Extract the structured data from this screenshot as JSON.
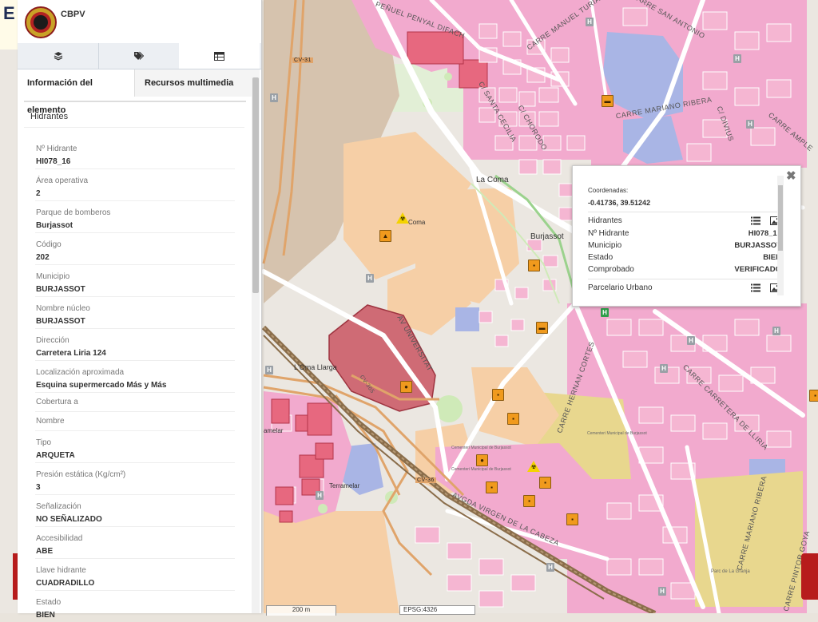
{
  "app": {
    "title": "CBPV"
  },
  "tabs": [
    {
      "icon": "layers-icon"
    },
    {
      "icon": "tags-icon"
    },
    {
      "icon": "table-icon"
    }
  ],
  "subtabs": {
    "info": "Información del elemento",
    "media": "Recursos multimedia"
  },
  "layer_title": "Hidrantes",
  "fields": [
    {
      "label": "Nº Hidrante",
      "value": "HI078_16"
    },
    {
      "label": "Área operativa",
      "value": "2"
    },
    {
      "label": "Parque de bomberos",
      "value": "Burjassot"
    },
    {
      "label": "Código",
      "value": "202"
    },
    {
      "label": "Municipio",
      "value": "BURJASSOT"
    },
    {
      "label": "Nombre núcleo",
      "value": "BURJASSOT"
    },
    {
      "label": "Dirección",
      "value": "Carretera Liria 124"
    },
    {
      "label": "Localización aproximada",
      "value": "Esquina supermercado Más y Más"
    },
    {
      "label": "Cobertura a",
      "value": ""
    },
    {
      "label": "Nombre",
      "value": ""
    },
    {
      "label": "Tipo",
      "value": "ARQUETA"
    },
    {
      "label": "Presión estática (Kg/cm²)",
      "value": "3"
    },
    {
      "label": "Señalización",
      "value": "NO SEÑALIZADO"
    },
    {
      "label": "Accesibilidad",
      "value": "ABE"
    },
    {
      "label": "Llave hidrante",
      "value": "CUADRADILLO"
    },
    {
      "label": "Estado",
      "value": "BIEN"
    }
  ],
  "popup": {
    "coord_label": "Coordenadas:",
    "coord_value": "-0.41736, 39.51242",
    "section1": "Hidrantes",
    "rows": [
      {
        "k": "Nº Hidrante",
        "v": "HI078_16"
      },
      {
        "k": "Municipio",
        "v": "BURJASSOT"
      },
      {
        "k": "Estado",
        "v": "BIEN"
      },
      {
        "k": "Comprobado",
        "v": "VERIFICADO"
      }
    ],
    "section2": "Parcelario Urbano",
    "close": "✖"
  },
  "map": {
    "streets": [
      "PEÑUEL PENYAL DIFACH",
      "CARRE MANUEL TURIAN",
      "CARRE SAN ANTONIO",
      "C/ SANTA CECILIA",
      "C/ CHORODO",
      "CARRE MARIANO RIBERA",
      "CARRE AMPLE",
      "C/ DIVIUS",
      "CARRE HERNAN CORTES",
      "AV UNIVERSITAT",
      "CARRE CARRETERA DE LLIRIA",
      "AVGDA VIRGEN DE LA CABEZA",
      "CARRE MARIANO RIBERA",
      "CARRE PINTOR GOYA",
      "CV-31",
      "CV-365",
      "CV-36"
    ],
    "places": [
      {
        "name": "La Coma"
      },
      {
        "name": "Burjassot"
      },
      {
        "name": "L'Oma Llarga"
      },
      {
        "name": "Coma"
      },
      {
        "name": "amelar"
      },
      {
        "name": "Terramelar"
      },
      {
        "name": "Cementeri Municipal de Burjassot"
      },
      {
        "name": "Cementeri Municipal de Burjassot"
      },
      {
        "name": "Cementeri Municipal de Burjassot"
      },
      {
        "name": "Parc de La Granja"
      }
    ],
    "scale": "200 m",
    "projection": "EPSG:4326"
  }
}
